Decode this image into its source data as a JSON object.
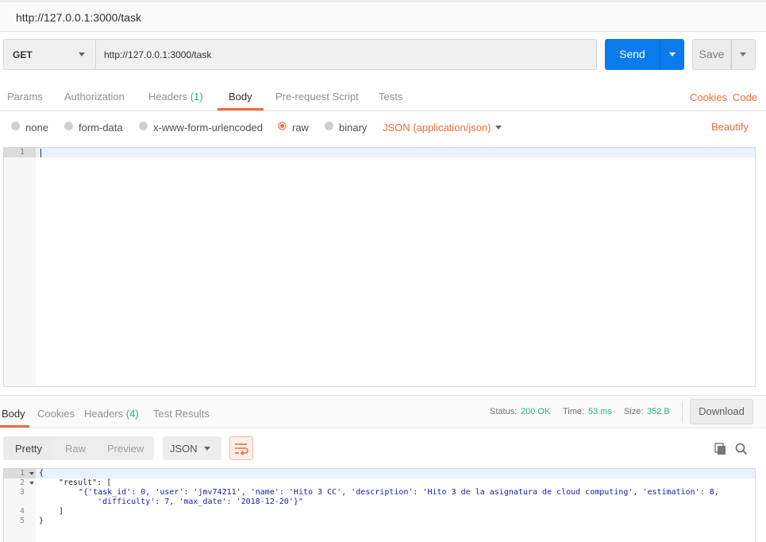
{
  "window": {
    "title": "http://127.0.0.1:3000/task"
  },
  "request": {
    "method": "GET",
    "url": "http://127.0.0.1:3000/task",
    "send_label": "Send",
    "save_label": "Save"
  },
  "request_tabs": {
    "params": "Params",
    "authorization": "Authorization",
    "headers": "Headers",
    "headers_count": "(1)",
    "body": "Body",
    "prerequest": "Pre-request Script",
    "tests": "Tests",
    "cookies": "Cookies",
    "code": "Code"
  },
  "body_options": {
    "none": "none",
    "form_data": "form-data",
    "urlencoded": "x-www-form-urlencoded",
    "raw": "raw",
    "binary": "binary",
    "content_type": "JSON (application/json)",
    "beautify": "Beautify",
    "selected": "raw"
  },
  "request_editor": {
    "line_numbers": [
      "1"
    ]
  },
  "response_tabs": {
    "body": "Body",
    "cookies": "Cookies",
    "headers": "Headers",
    "headers_count": "(4)",
    "test_results": "Test Results"
  },
  "response_meta": {
    "status_label": "Status:",
    "status_value": "200 OK",
    "time_label": "Time:",
    "time_value": "53 ms",
    "size_label": "Size:",
    "size_value": "352 B",
    "download": "Download"
  },
  "response_toolbar": {
    "pretty": "Pretty",
    "raw": "Raw",
    "preview": "Preview",
    "format": "JSON"
  },
  "response_body": {
    "line_numbers": [
      "1",
      "2",
      "3",
      "",
      "4",
      "5"
    ],
    "line1": "{",
    "line2_key": "\"result\"",
    "line2_rest": ": [",
    "line3a": "\"{'task_id': 0, 'user': 'jmv74211', 'name': 'Hito 3 CC', 'description': 'Hito 3 de la asignatura de cloud computing', 'estimation': 8,",
    "line3b": "'difficulty': 7, 'max_date': '2018-12-20'}\"",
    "line4": "]",
    "line5": "}"
  },
  "colors": {
    "accent": "#f26b3a",
    "send_blue": "#097bed",
    "success_green": "#26b47f"
  }
}
